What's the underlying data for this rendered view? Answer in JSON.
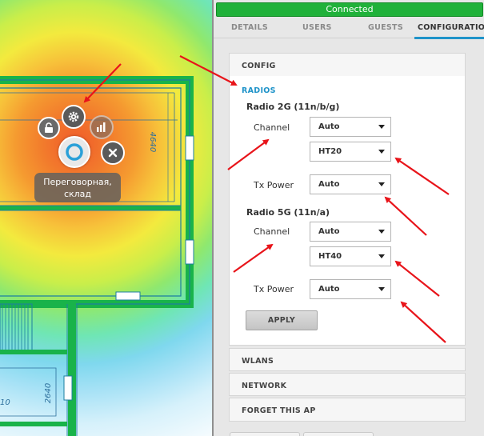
{
  "map": {
    "room_label_line1": "Переговорная,",
    "room_label_line2": "склад",
    "dimension_1": "4640",
    "dimension_2": "2640",
    "dimension_3": "10",
    "buttons": {
      "lock": "lock-icon",
      "gear": "gear-icon",
      "stats": "bar-chart-icon",
      "access_point": "access-point-icon",
      "close": "close-icon"
    }
  },
  "status": {
    "text": "Connected",
    "color": "#20b13a"
  },
  "tabs": [
    {
      "label": "DETAILS",
      "active": false
    },
    {
      "label": "USERS",
      "active": false
    },
    {
      "label": "GUESTS",
      "active": false
    },
    {
      "label": "CONFIGURATION",
      "active": true
    }
  ],
  "config": {
    "title": "CONFIG",
    "radios_label": "RADIOS",
    "radio_2g": {
      "title": "Radio 2G (11n/b/g)",
      "channel_label": "Channel",
      "channel_value": "Auto",
      "width_value": "HT20",
      "txpower_label": "Tx Power",
      "txpower_value": "Auto"
    },
    "radio_5g": {
      "title": "Radio 5G (11n/a)",
      "channel_label": "Channel",
      "channel_value": "Auto",
      "width_value": "HT40",
      "txpower_label": "Tx Power",
      "txpower_value": "Auto"
    },
    "apply_label": "APPLY"
  },
  "sections": {
    "wlans": "WLANS",
    "network": "NETWORK",
    "forget": "FORGET THIS AP"
  },
  "accent_color": "#1f93c9",
  "annotation_color": "#e8141a"
}
